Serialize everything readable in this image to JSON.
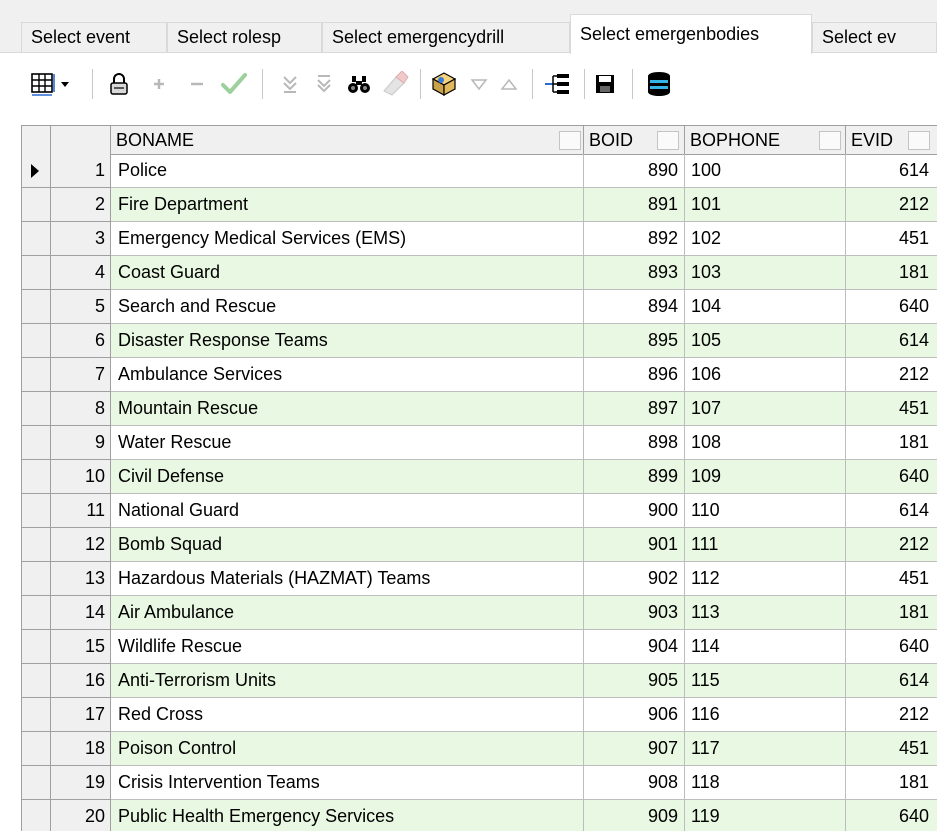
{
  "tabs": [
    {
      "label": "Select event"
    },
    {
      "label": "Select rolesp"
    },
    {
      "label": "Select emergencydrill"
    },
    {
      "label": "Select emergenbodies"
    },
    {
      "label": "Select ev"
    }
  ],
  "active_tab": 3,
  "toolbar": {
    "icons": [
      "grid-layout-icon",
      "dropdown-arrow-icon",
      "lock-icon",
      "plus-icon",
      "minus-icon",
      "check-icon",
      "filter-down-icon",
      "filter-clear-icon",
      "binoculars-icon",
      "eraser-icon",
      "import-icon",
      "sort-ascending-icon",
      "sort-descending-icon",
      "tree-icon",
      "save-icon",
      "database-icon"
    ]
  },
  "grid": {
    "columns": [
      "BONAME",
      "BOID",
      "BOPHONE",
      "EVID"
    ],
    "current_row": 1,
    "rows": [
      {
        "n": "1",
        "boname": "Police",
        "boid": "890",
        "bophone": "100",
        "evid": "614"
      },
      {
        "n": "2",
        "boname": "Fire Department",
        "boid": "891",
        "bophone": "101",
        "evid": "212"
      },
      {
        "n": "3",
        "boname": "Emergency Medical Services (EMS)",
        "boid": "892",
        "bophone": "102",
        "evid": "451"
      },
      {
        "n": "4",
        "boname": "Coast Guard",
        "boid": "893",
        "bophone": "103",
        "evid": "181"
      },
      {
        "n": "5",
        "boname": "Search and Rescue",
        "boid": "894",
        "bophone": "104",
        "evid": "640"
      },
      {
        "n": "6",
        "boname": "Disaster Response Teams",
        "boid": "895",
        "bophone": "105",
        "evid": "614"
      },
      {
        "n": "7",
        "boname": "Ambulance Services",
        "boid": "896",
        "bophone": "106",
        "evid": "212"
      },
      {
        "n": "8",
        "boname": "Mountain Rescue",
        "boid": "897",
        "bophone": "107",
        "evid": "451"
      },
      {
        "n": "9",
        "boname": "Water Rescue",
        "boid": "898",
        "bophone": "108",
        "evid": "181"
      },
      {
        "n": "10",
        "boname": "Civil Defense",
        "boid": "899",
        "bophone": "109",
        "evid": "640"
      },
      {
        "n": "11",
        "boname": "National Guard",
        "boid": "900",
        "bophone": "110",
        "evid": "614"
      },
      {
        "n": "12",
        "boname": "Bomb Squad",
        "boid": "901",
        "bophone": "111",
        "evid": "212"
      },
      {
        "n": "13",
        "boname": "Hazardous Materials (HAZMAT) Teams",
        "boid": "902",
        "bophone": "112",
        "evid": "451"
      },
      {
        "n": "14",
        "boname": "Air Ambulance",
        "boid": "903",
        "bophone": "113",
        "evid": "181"
      },
      {
        "n": "15",
        "boname": "Wildlife Rescue",
        "boid": "904",
        "bophone": "114",
        "evid": "640"
      },
      {
        "n": "16",
        "boname": "Anti-Terrorism Units",
        "boid": "905",
        "bophone": "115",
        "evid": "614"
      },
      {
        "n": "17",
        "boname": "Red Cross",
        "boid": "906",
        "bophone": "116",
        "evid": "212"
      },
      {
        "n": "18",
        "boname": "Poison Control",
        "boid": "907",
        "bophone": "117",
        "evid": "451"
      },
      {
        "n": "19",
        "boname": "Crisis Intervention Teams",
        "boid": "908",
        "bophone": "118",
        "evid": "181"
      },
      {
        "n": "20",
        "boname": "Public Health Emergency Services",
        "boid": "909",
        "bophone": "119",
        "evid": "640"
      }
    ]
  },
  "colors": {
    "alt_row": "#e9f8e2",
    "header": "#f0f0f0"
  }
}
